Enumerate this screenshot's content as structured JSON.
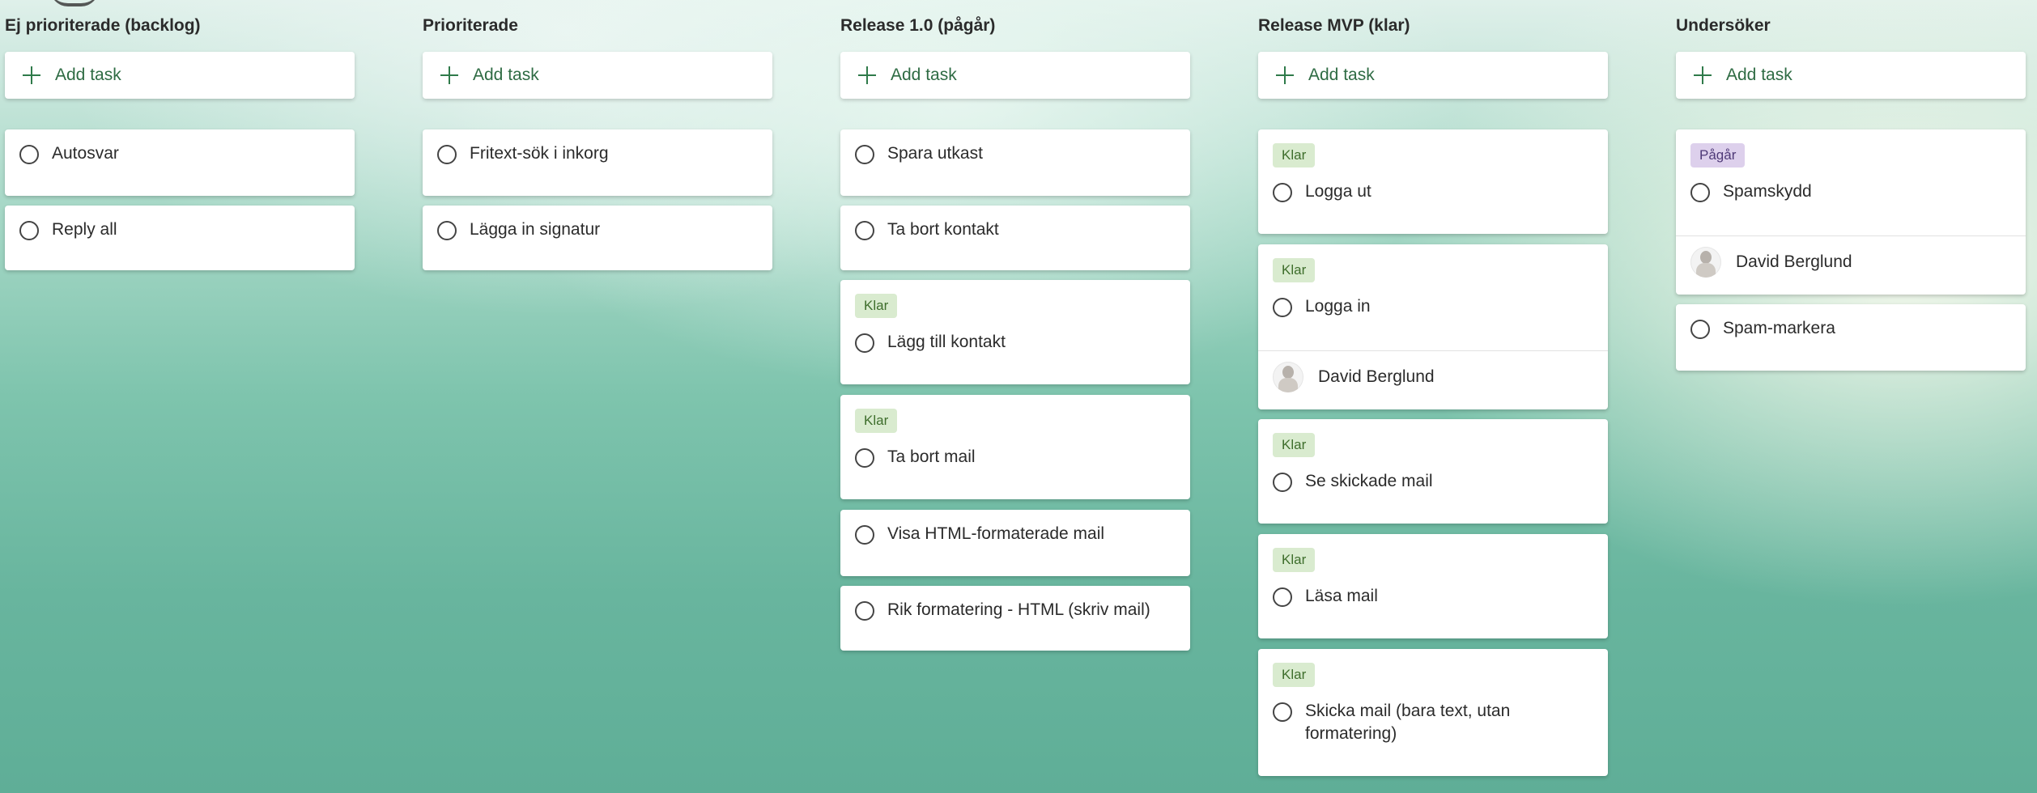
{
  "add_task_label": "Add task",
  "columns": [
    {
      "title": "Ej prioriterade (backlog)",
      "cards": [
        {
          "title": "Autosvar"
        },
        {
          "title": "Reply all"
        }
      ]
    },
    {
      "title": "Prioriterade",
      "cards": [
        {
          "title": "Fritext-sök i inkorg"
        },
        {
          "title": "Lägga in signatur"
        }
      ]
    },
    {
      "title": "Release 1.0 (pågår)",
      "cards": [
        {
          "title": "Spara utkast"
        },
        {
          "title": "Ta bort kontakt"
        },
        {
          "label": "Klar",
          "title": "Lägg till kontakt"
        },
        {
          "label": "Klar",
          "title": "Ta bort mail"
        },
        {
          "title": "Visa HTML-formaterade mail"
        },
        {
          "title": "Rik formatering - HTML (skriv mail)"
        }
      ]
    },
    {
      "title": "Release MVP (klar)",
      "cards": [
        {
          "label": "Klar",
          "title": "Logga ut"
        },
        {
          "label": "Klar",
          "title": "Logga in",
          "assignee": "David Berglund"
        },
        {
          "label": "Klar",
          "title": "Se skickade mail"
        },
        {
          "label": "Klar",
          "title": "Läsa mail"
        },
        {
          "label": "Klar",
          "title": "Skicka mail (bara text, utan formatering)"
        }
      ]
    },
    {
      "title": "Undersöker",
      "cards": [
        {
          "label": "Pågår",
          "title": "Spamskydd",
          "assignee": "David Berglund"
        },
        {
          "title": "Spam-markera"
        }
      ]
    }
  ],
  "colors": {
    "label_klar_bg": "#d9ebcf",
    "label_pagar_bg": "#ddd0ec",
    "add_task_accent": "#2f7a4a"
  }
}
